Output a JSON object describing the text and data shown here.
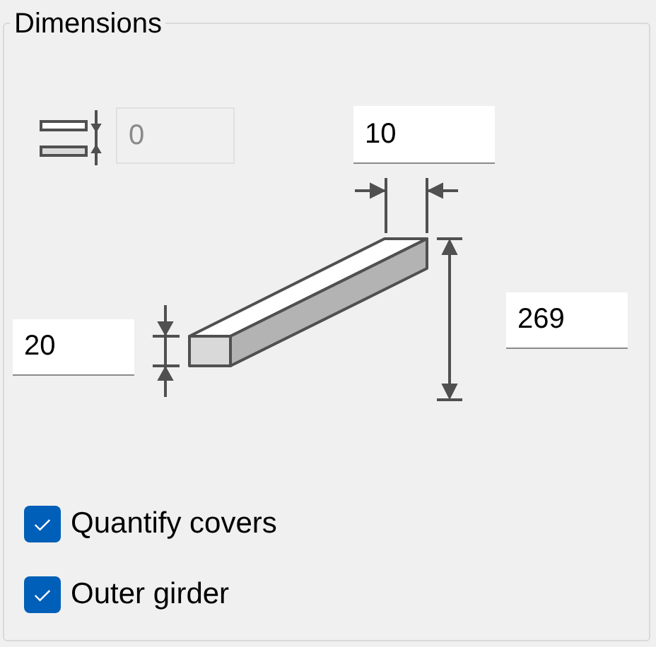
{
  "group": {
    "title": "Dimensions"
  },
  "fields": [
    {
      "kind": "gap",
      "value": "0",
      "disabled": true
    },
    {
      "kind": "width",
      "value": "10",
      "disabled": false
    },
    {
      "kind": "thickness",
      "value": "20",
      "disabled": false
    },
    {
      "kind": "length",
      "value": "269",
      "disabled": false
    }
  ],
  "checkboxes": [
    {
      "label": "Quantify covers",
      "checked": true
    },
    {
      "label": "Outer girder",
      "checked": true
    }
  ]
}
